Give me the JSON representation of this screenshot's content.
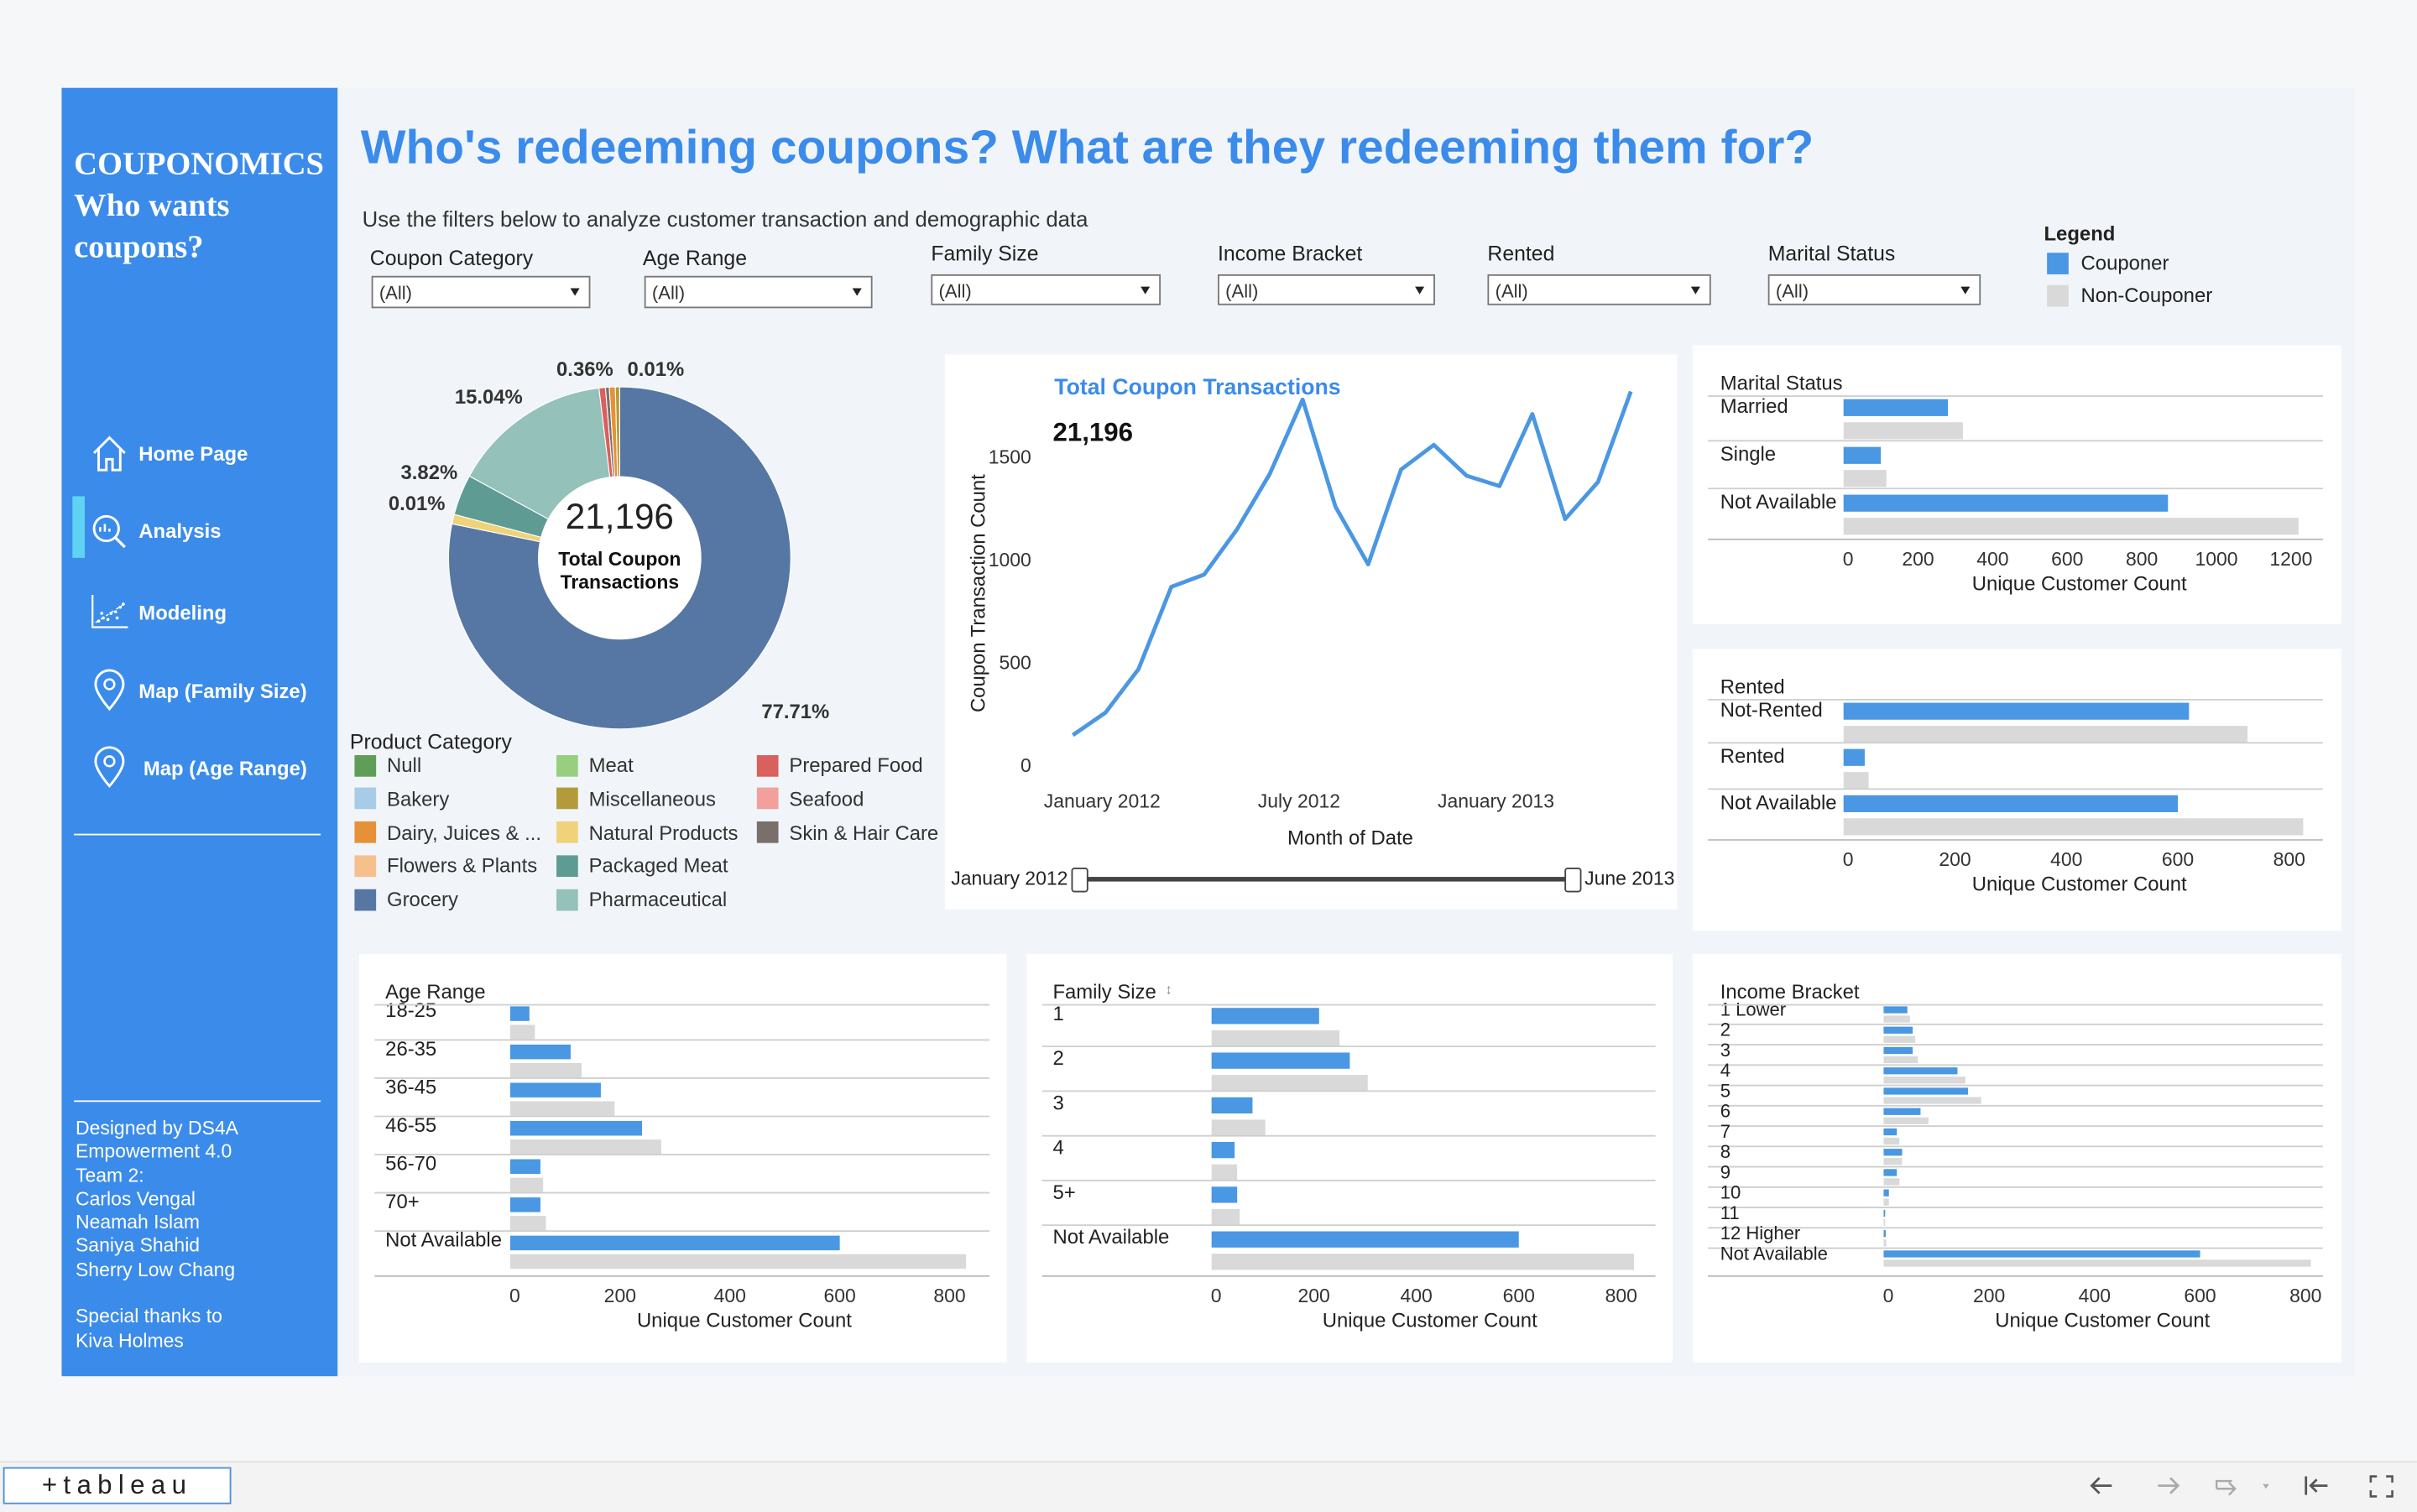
{
  "sidebar": {
    "brand": "COUPONOMICS\nWho wants\ncoupons?",
    "nav": [
      {
        "label": "Home Page",
        "icon": "home-icon"
      },
      {
        "label": "Analysis",
        "icon": "analysis-icon"
      },
      {
        "label": "Modeling",
        "icon": "scatter-icon"
      },
      {
        "label": "Map (Family Size)",
        "icon": "map-pin-icon"
      },
      {
        "label": "Map (Age Range)",
        "icon": "map-pin-icon"
      }
    ],
    "active": "Analysis",
    "credits": "Designed by DS4A\nEmpowerment 4.0\nTeam 2:\nCarlos Vengal\nNeamah Islam\nSaniya Shahid\nSherry Low Chang\n\nSpecial thanks to\nKiva Holmes"
  },
  "header": {
    "title": "Who's redeeming coupons? What are they redeeming them for?",
    "subtitle": "Use the filters below to analyze customer transaction and demographic data"
  },
  "filters": [
    {
      "label": "Coupon Category",
      "value": "(All)"
    },
    {
      "label": "Age Range",
      "value": "(All)"
    },
    {
      "label": "Family Size",
      "value": "(All)"
    },
    {
      "label": "Income Bracket",
      "value": "(All)"
    },
    {
      "label": "Rented",
      "value": "(All)"
    },
    {
      "label": "Marital Status",
      "value": "(All)"
    }
  ],
  "legend": {
    "title": "Legend",
    "items": [
      {
        "label": "Couponer",
        "color": "#4a97e3"
      },
      {
        "label": "Non-Couponer",
        "color": "#d9d9d9"
      }
    ]
  },
  "colors": {
    "couponer": "#4a97e3",
    "non_couponer": "#d9d9d9",
    "accent": "#3b8beb"
  },
  "product_legend": {
    "title": "Product Category",
    "items": [
      {
        "label": "Null",
        "color": "#5f9e58"
      },
      {
        "label": "Bakery",
        "color": "#a8cbe7"
      },
      {
        "label": "Dairy, Juices & ...",
        "color": "#e69138"
      },
      {
        "label": "Flowers & Plants",
        "color": "#f6c08c"
      },
      {
        "label": "Grocery",
        "color": "#5677a4"
      },
      {
        "label": "Meat",
        "color": "#97cf7f"
      },
      {
        "label": "Miscellaneous",
        "color": "#b39b3b"
      },
      {
        "label": "Natural Products",
        "color": "#f0d27a"
      },
      {
        "label": "Packaged Meat",
        "color": "#5e9c93"
      },
      {
        "label": "Pharmaceutical",
        "color": "#94c1b9"
      },
      {
        "label": "Prepared Food",
        "color": "#d9605d"
      },
      {
        "label": "Seafood",
        "color": "#f2a09c"
      },
      {
        "label": "Skin & Hair Care",
        "color": "#7a706b"
      }
    ]
  },
  "chart_data": [
    {
      "type": "pie",
      "center_value": "21,196",
      "center_label": "Total Coupon Transactions",
      "slices": [
        {
          "label": "Grocery",
          "percent": 77.71,
          "color": "#5677a4",
          "display": "77.71%"
        },
        {
          "label": "Natural Products",
          "percent": 0.9,
          "color": "#f0d27a",
          "display": "0.01%"
        },
        {
          "label": "Packaged Meat",
          "percent": 3.82,
          "color": "#5e9c93",
          "display": "3.82%"
        },
        {
          "label": "Pharmaceutical",
          "percent": 15.04,
          "color": "#94c1b9",
          "display": "15.04%"
        },
        {
          "label": "Prepared Food",
          "percent": 0.6,
          "color": "#d9605d",
          "display": ""
        },
        {
          "label": "Skin & Hair Care",
          "percent": 0.36,
          "color": "#7a706b",
          "display": "0.36%"
        },
        {
          "label": "Dairy, Juices & ...",
          "percent": 0.56,
          "color": "#e69138",
          "display": "0.01%"
        },
        {
          "label": "Miscellaneous",
          "percent": 0.4,
          "color": "#b39b3b",
          "display": ""
        }
      ]
    },
    {
      "type": "line",
      "title": "Total Coupon Transactions",
      "big_number": "21,196",
      "xlabel": "Month of Date",
      "ylabel": "Coupon Transaction Count",
      "x_tick_labels": [
        "January 2012",
        "July 2012",
        "January 2013"
      ],
      "y_ticks": [
        0,
        500,
        1000,
        1500
      ],
      "ylim": [
        0,
        1850
      ],
      "x": [
        "2012-01",
        "2012-02",
        "2012-03",
        "2012-04",
        "2012-05",
        "2012-06",
        "2012-07",
        "2012-08",
        "2012-09",
        "2012-10",
        "2012-11",
        "2012-12",
        "2013-01",
        "2013-02",
        "2013-03",
        "2013-04",
        "2013-05",
        "2013-06"
      ],
      "values": [
        150,
        260,
        470,
        870,
        930,
        1150,
        1420,
        1780,
        1260,
        980,
        1440,
        1560,
        1410,
        1360,
        1710,
        1200,
        1380,
        1820
      ],
      "slider": {
        "start": "January 2012",
        "end": "June 2013"
      }
    },
    {
      "type": "bar",
      "title": "Marital Status",
      "xlabel": "Unique Customer Count",
      "ticks": [
        0,
        200,
        400,
        600,
        800,
        1000,
        1200
      ],
      "xlim": [
        0,
        1240
      ],
      "categories": [
        "Married",
        "Single",
        "Not Available"
      ],
      "series": [
        {
          "name": "Couponer",
          "values": [
            280,
            100,
            870
          ]
        },
        {
          "name": "Non-Couponer",
          "values": [
            320,
            115,
            1220
          ]
        }
      ]
    },
    {
      "type": "bar",
      "title": "Rented",
      "xlabel": "Unique Customer Count",
      "ticks": [
        0,
        200,
        400,
        600,
        800
      ],
      "xlim": [
        0,
        830
      ],
      "categories": [
        "Not-Rented",
        "Rented",
        "Not Available"
      ],
      "series": [
        {
          "name": "Couponer",
          "values": [
            620,
            38,
            600
          ]
        },
        {
          "name": "Non-Couponer",
          "values": [
            725,
            45,
            825
          ]
        }
      ]
    },
    {
      "type": "bar",
      "title": "Age Range",
      "xlabel": "Unique Customer Count",
      "ticks": [
        0,
        200,
        400,
        600,
        800
      ],
      "xlim": [
        0,
        870
      ],
      "categories": [
        "18-25",
        "26-35",
        "36-45",
        "46-55",
        "56-70",
        "70+",
        "Not Available"
      ],
      "series": [
        {
          "name": "Couponer",
          "values": [
            35,
            110,
            165,
            240,
            55,
            55,
            600
          ]
        },
        {
          "name": "Non-Couponer",
          "values": [
            45,
            130,
            190,
            275,
            60,
            65,
            830
          ]
        }
      ]
    },
    {
      "type": "bar",
      "title": "Family Size",
      "xlabel": "Unique Customer Count",
      "ticks": [
        0,
        200,
        400,
        600,
        800
      ],
      "xlim": [
        0,
        870
      ],
      "categories": [
        "1",
        "2",
        "3",
        "4",
        "5+",
        "Not Available"
      ],
      "series": [
        {
          "name": "Couponer",
          "values": [
            210,
            270,
            80,
            45,
            50,
            600
          ]
        },
        {
          "name": "Non-Couponer",
          "values": [
            250,
            305,
            105,
            50,
            55,
            825
          ]
        }
      ]
    },
    {
      "type": "bar",
      "title": "Income Bracket",
      "xlabel": "Unique Customer Count",
      "ticks": [
        0,
        200,
        400,
        600,
        800
      ],
      "xlim": [
        0,
        830
      ],
      "categories": [
        "1 Lower",
        "2",
        "3",
        "4",
        "5",
        "6",
        "7",
        "8",
        "9",
        "10",
        "11",
        "12 Higher",
        "Not Available"
      ],
      "series": [
        {
          "name": "Couponer",
          "values": [
            45,
            55,
            55,
            140,
            160,
            70,
            25,
            35,
            25,
            10,
            3,
            4,
            600
          ]
        },
        {
          "name": "Non-Couponer",
          "values": [
            50,
            60,
            65,
            155,
            185,
            85,
            30,
            35,
            30,
            10,
            3,
            5,
            810
          ]
        }
      ]
    }
  ],
  "footer": {
    "logo": "+tableau"
  }
}
